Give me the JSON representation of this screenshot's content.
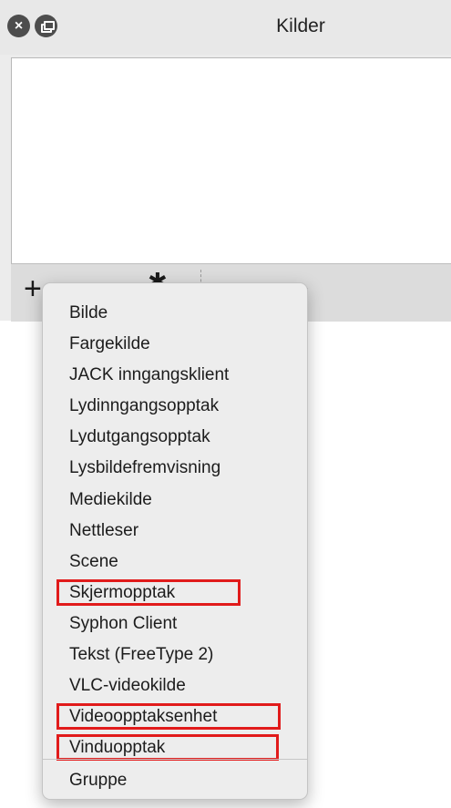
{
  "window": {
    "title": "Kilder",
    "close_icon": "×",
    "float_icon_name": "float-icon"
  },
  "toolbar": {
    "add_icon": "+",
    "gear_icon": "✱",
    "up_icon": "⌃",
    "down_icon": "⌄"
  },
  "menu": {
    "items": [
      {
        "label": "Bilde",
        "highlighted": false
      },
      {
        "label": "Fargekilde",
        "highlighted": false
      },
      {
        "label": "JACK inngangsklient",
        "highlighted": false
      },
      {
        "label": "Lydinngangsopptak",
        "highlighted": false
      },
      {
        "label": "Lydutgangsopptak",
        "highlighted": false
      },
      {
        "label": "Lysbildefremvisning",
        "highlighted": false
      },
      {
        "label": "Mediekilde",
        "highlighted": false
      },
      {
        "label": "Nettleser",
        "highlighted": false
      },
      {
        "label": "Scene",
        "highlighted": false
      },
      {
        "label": "Skjermopptak",
        "highlighted": true
      },
      {
        "label": "Syphon Client",
        "highlighted": false
      },
      {
        "label": "Tekst (FreeType 2)",
        "highlighted": false
      },
      {
        "label": "VLC-videokilde",
        "highlighted": false
      },
      {
        "label": "Videoopptaksenhet",
        "highlighted": true
      },
      {
        "label": "Vinduopptak",
        "highlighted": true
      }
    ],
    "group_label": "Gruppe"
  },
  "colors": {
    "highlight_box": "#e11b1b",
    "menu_background": "#ededed",
    "titlebar_button": "#4d4d4d"
  }
}
